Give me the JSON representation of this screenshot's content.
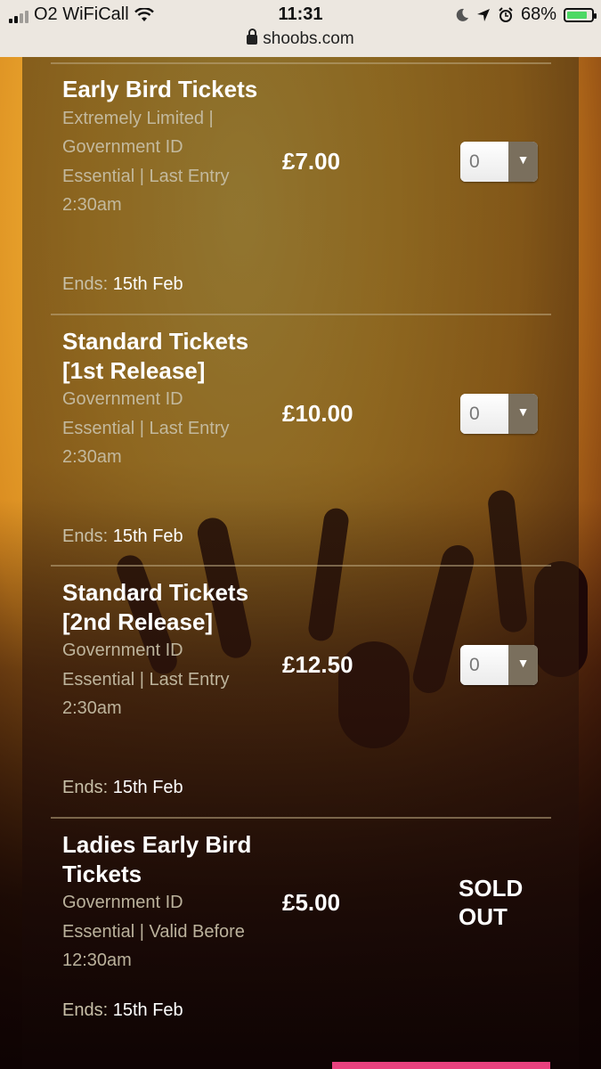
{
  "status_bar": {
    "carrier": "O2 WiFiCall",
    "time": "11:31",
    "battery": "68%",
    "icons": [
      "signal-icon",
      "wifi-icon",
      "moon-icon",
      "location-icon",
      "alarm-icon",
      "battery-charging-icon"
    ]
  },
  "browser": {
    "url": "shoobs.com"
  },
  "tickets": [
    {
      "title": "Early Bird Tickets",
      "description": "Extremely Limited | Government ID Essential | Last Entry 2:30am",
      "ends_label": "Ends:",
      "ends_date": "15th Feb",
      "price": "£7.00",
      "quantity": "0"
    },
    {
      "title": "Standard Tickets [1st Release]",
      "description": "Government ID Essential | Last Entry 2:30am",
      "ends_label": "Ends:",
      "ends_date": "15th Feb",
      "price": "£10.00",
      "quantity": "0"
    },
    {
      "title": "Standard Tickets [2nd Release]",
      "description": "Government ID Essential | Last Entry 2:30am",
      "ends_label": "Ends:",
      "ends_date": "15th Feb",
      "price": "£12.50",
      "quantity": "0"
    },
    {
      "title": "Ladies Early Bird Tickets",
      "description": "Government ID Essential | Valid Before 12:30am",
      "ends_label": "Ends:",
      "ends_date": "15th Feb",
      "price": "£5.00",
      "status": "SOLD OUT"
    }
  ],
  "colors": {
    "accent_pink": "#e8417e",
    "background_gold": "#f7b63a"
  }
}
